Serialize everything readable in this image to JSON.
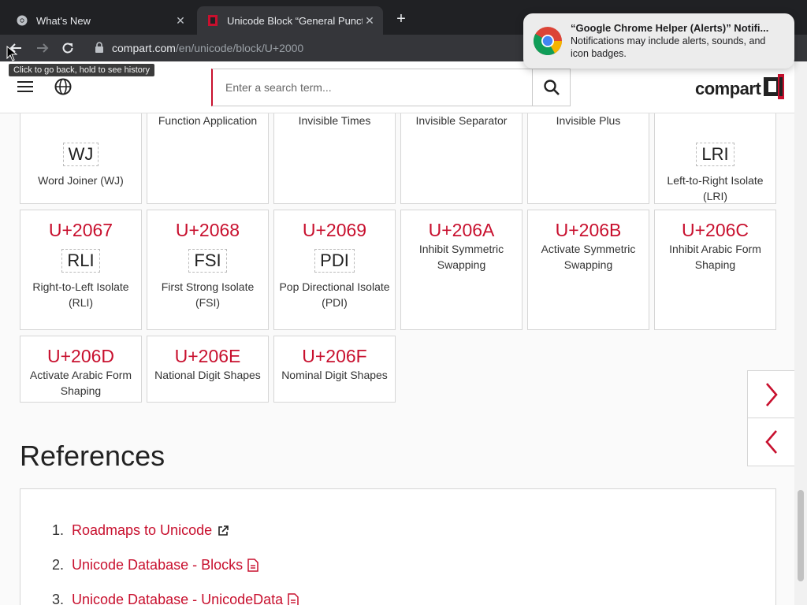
{
  "browser": {
    "tabs": [
      {
        "title": "What's New",
        "close": "✕"
      },
      {
        "title": "Unicode Block “General Punctuation”",
        "close": "✕"
      }
    ],
    "new_tab": "+",
    "url_host": "compart.com",
    "url_path": "/en/unicode/block/U+2000",
    "back_tooltip": "Click to go back, hold to see history"
  },
  "notification": {
    "title": "“Google Chrome Helper (Alerts)” Notifi...",
    "body": "Notifications may include alerts, sounds, and icon badges."
  },
  "header": {
    "search_placeholder": "Enter a search term...",
    "logo": "compart"
  },
  "grid": {
    "row0": [
      {
        "code": "",
        "glyph": "",
        "name": "Function Application"
      },
      {
        "code": "",
        "glyph": "",
        "name": "Invisible Times"
      },
      {
        "code": "",
        "glyph": "",
        "name": "Invisible Separator"
      },
      {
        "code": "",
        "glyph": "",
        "name": "Invisible Plus"
      }
    ],
    "row0_glyph": [
      {
        "glyph": "WJ",
        "name": "Word Joiner (WJ)"
      },
      {
        "glyph": "LRI",
        "name": "Left-to-Right Isolate (LRI)"
      }
    ],
    "row1": [
      {
        "code": "U+2067",
        "glyph": "RLI",
        "name": "Right-to-Left Isolate (RLI)"
      },
      {
        "code": "U+2068",
        "glyph": "FSI",
        "name": "First Strong Isolate (FSI)"
      },
      {
        "code": "U+2069",
        "glyph": "PDI",
        "name": "Pop Directional Isolate (PDI)"
      },
      {
        "code": "U+206A",
        "name": "Inhibit Symmetric Swapping"
      },
      {
        "code": "U+206B",
        "name": "Activate Symmetric Swapping"
      },
      {
        "code": "U+206C",
        "name": "Inhibit Arabic Form Shaping"
      }
    ],
    "row2": [
      {
        "code": "U+206D",
        "name": "Activate Arabic Form Shaping"
      },
      {
        "code": "U+206E",
        "name": "National Digit Shapes"
      },
      {
        "code": "U+206F",
        "name": "Nominal Digit Shapes"
      }
    ]
  },
  "references": {
    "title": "References",
    "items": [
      {
        "num": "1.",
        "label": "Roadmaps to Unicode",
        "icon": "external-link-icon"
      },
      {
        "num": "2.",
        "label": "Unicode Database - Blocks",
        "icon": "document-icon"
      },
      {
        "num": "3.",
        "label": "Unicode Database - UnicodeData",
        "icon": "document-icon"
      }
    ]
  },
  "colors": {
    "accent": "#c8102e",
    "chrome_dark": "#202124",
    "chrome_toolbar": "#35363a"
  }
}
